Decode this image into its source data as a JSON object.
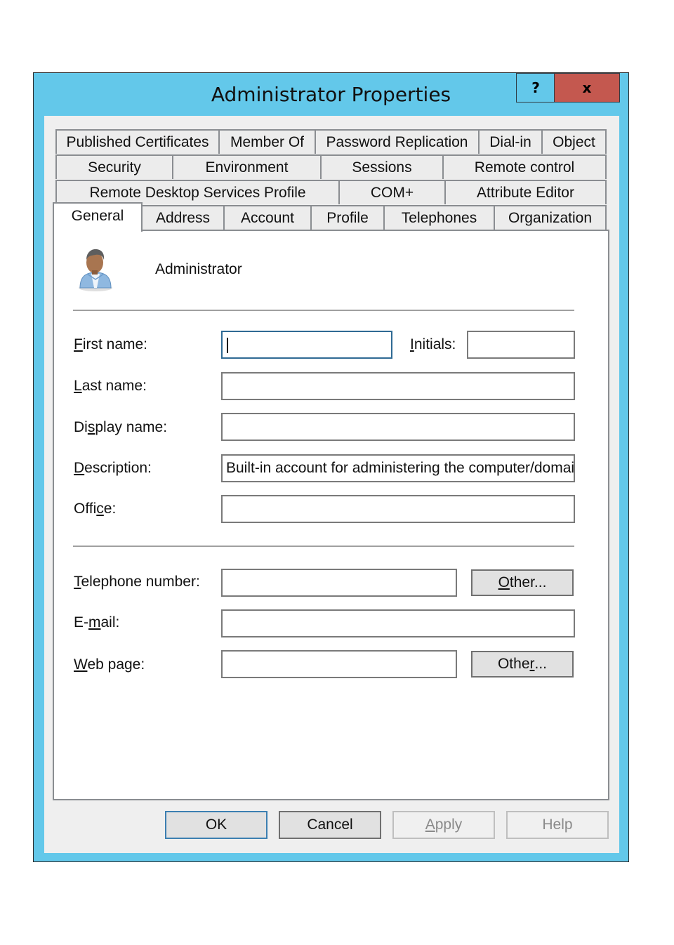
{
  "window": {
    "title": "Administrator Properties",
    "help_label": "?",
    "close_label": "x",
    "colors": {
      "frame": "#63c8ea",
      "close": "#c4584f",
      "focus_border": "#2f6a94"
    }
  },
  "tabs": {
    "row1": [
      "Published Certificates",
      "Member Of",
      "Password Replication",
      "Dial-in",
      "Object"
    ],
    "row2": [
      "Security",
      "Environment",
      "Sessions",
      "Remote control"
    ],
    "row3": [
      "Remote Desktop Services Profile",
      "COM+",
      "Attribute Editor"
    ],
    "row4": [
      "General",
      "Address",
      "Account",
      "Profile",
      "Telephones",
      "Organization"
    ],
    "active": "General"
  },
  "general": {
    "account_name": "Administrator",
    "fields": {
      "first_name": {
        "label_key": "F",
        "label_rest": "irst name:",
        "value": ""
      },
      "initials": {
        "label_key": "I",
        "label_rest": "nitials:",
        "value": ""
      },
      "last_name": {
        "label_key": "L",
        "label_rest": "ast name:",
        "value": ""
      },
      "display_name": {
        "label_pre": "Di",
        "label_key": "s",
        "label_rest": "play name:",
        "value": ""
      },
      "description": {
        "label_key": "D",
        "label_rest": "escription:",
        "value": "Built-in account for administering the computer/domain"
      },
      "office": {
        "label_pre": "Offi",
        "label_key": "c",
        "label_rest": "e:",
        "value": ""
      },
      "telephone": {
        "label_key": "T",
        "label_rest": "elephone number:",
        "value": ""
      },
      "email": {
        "label_pre": "E-",
        "label_key": "m",
        "label_rest": "ail:",
        "value": ""
      },
      "web_page": {
        "label_key": "W",
        "label_rest": "eb page:",
        "value": ""
      }
    },
    "other_phone": {
      "key": "O",
      "rest": "ther..."
    },
    "other_web": {
      "pre": "Othe",
      "key": "r",
      "rest": "..."
    }
  },
  "footer": {
    "ok": "OK",
    "cancel": "Cancel",
    "apply_key": "A",
    "apply_rest": "pply",
    "help": "Help"
  }
}
